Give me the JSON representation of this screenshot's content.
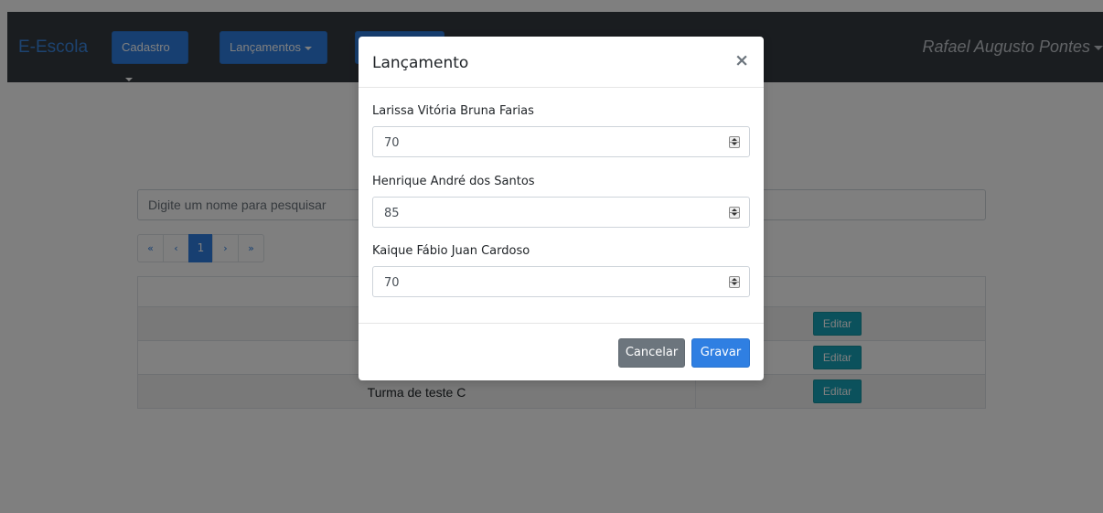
{
  "navbar": {
    "brand": "E-Escola",
    "menus": [
      {
        "label": "Cadastro"
      },
      {
        "label": "Lançamentos"
      },
      {
        "label": ""
      }
    ],
    "user": "Rafael Augusto Pontes"
  },
  "search": {
    "placeholder": "Digite um nome para pesquisar"
  },
  "pagination": {
    "first": "«",
    "prev": "‹",
    "current": "1",
    "next": "›",
    "last": "»"
  },
  "table": {
    "rows": [
      {
        "name": "",
        "action": "Editar"
      },
      {
        "name": "",
        "action": "Editar"
      },
      {
        "name": "Turma de teste C",
        "action": "Editar"
      }
    ]
  },
  "modal": {
    "title": "Lançamento",
    "close": "×",
    "fields": [
      {
        "label": "Larissa Vitória Bruna Farias",
        "value": "70"
      },
      {
        "label": "Henrique André dos Santos",
        "value": "85"
      },
      {
        "label": "Kaique Fábio Juan Cardoso",
        "value": "70"
      }
    ],
    "cancel_label": "Cancelar",
    "save_label": "Gravar"
  },
  "colors": {
    "navbar_bg": "#343a40",
    "primary": "#2f7fe2",
    "secondary": "#6c757d",
    "info": "#17a2b8"
  }
}
